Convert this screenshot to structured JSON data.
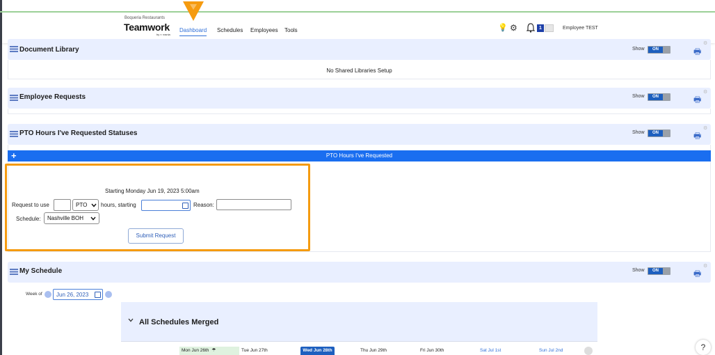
{
  "header": {
    "org_name": "Boqueria Restaurants",
    "app_name": "Teamwork",
    "app_by": "by ◐ rosnia",
    "nav": [
      "Dashboard",
      "Schedules",
      "Employees",
      "Tools"
    ],
    "notification_count": "1",
    "user_name": "Employee TEST"
  },
  "panels": {
    "doc_library": {
      "title": "Document Library",
      "message": "No Shared Libraries Setup"
    },
    "employee_requests": {
      "title": "Employee Requests"
    },
    "pto_statuses": {
      "title": "PTO Hours I've Requested Statuses"
    },
    "my_schedule": {
      "title": "My Schedule"
    },
    "show_label": "Show",
    "toggle_label": "ON"
  },
  "pto_form": {
    "bar_label": "PTO Hours I've Requested",
    "plus": "+",
    "starting_text": "Starting Monday Jun 19, 2023 5:00am",
    "request_label": "Request to use",
    "hours_value": "",
    "type_selected": "PTO",
    "hours_starting_label": "hours, starting",
    "date_value": "",
    "reason_label": "Reason:",
    "reason_value": "",
    "schedule_label": "Schedule:",
    "schedule_selected": "Nashville BOH",
    "submit_label": "Submit Request"
  },
  "schedule": {
    "week_label": "Week of",
    "week_value": "Jun 26, 2023",
    "merged_title": "All Schedules Merged",
    "days": [
      "Mon Jun 26th",
      "Tue Jun 27th",
      "Wed Jun 28th",
      "Thu Jun 29th",
      "Fri Jun 30th",
      "Sat Jul 1st",
      "Sun Jul 2nd"
    ]
  },
  "help_label": "?",
  "colors": {
    "accent": "#1a6ef0",
    "highlight": "#f59b10",
    "panel_bg": "#e9efff",
    "today_bg": "#1d5fbf"
  }
}
